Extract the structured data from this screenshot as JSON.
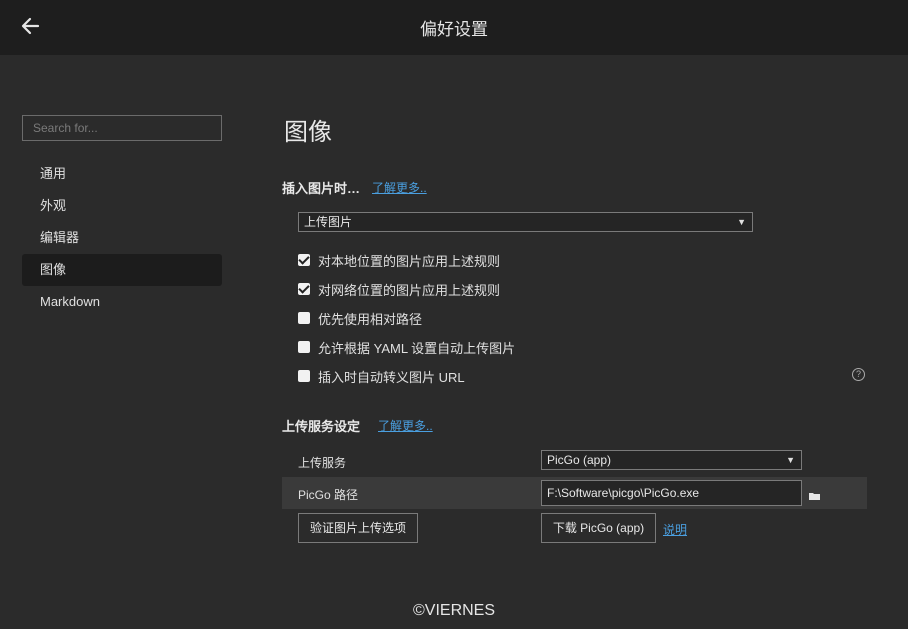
{
  "header": {
    "title": "偏好设置",
    "back_icon": "arrow-left-icon"
  },
  "sidebar": {
    "search_placeholder": "Search for...",
    "items": [
      {
        "label": "通用"
      },
      {
        "label": "外观"
      },
      {
        "label": "编辑器"
      },
      {
        "label": "图像",
        "active": true
      },
      {
        "label": "Markdown"
      }
    ]
  },
  "main": {
    "title": "图像",
    "insert_section": {
      "title": "插入图片时…",
      "learn_more": "了解更多..",
      "action_select": "上传图片",
      "options": [
        {
          "label": "对本地位置的图片应用上述规则",
          "checked": true
        },
        {
          "label": "对网络位置的图片应用上述规则",
          "checked": true
        },
        {
          "label": "优先使用相对路径",
          "checked": false
        },
        {
          "label": "允许根据 YAML 设置自动上传图片",
          "checked": false
        },
        {
          "label": "插入时自动转义图片 URL",
          "checked": false
        }
      ],
      "help_icon": "question-circle-icon"
    },
    "upload_section": {
      "title": "上传服务设定",
      "learn_more": "了解更多..",
      "service_label": "上传服务",
      "service_value": "PicGo (app)",
      "path_label": "PicGo 路径",
      "path_value": "F:\\Software\\picgo\\PicGo.exe",
      "folder_icon": "folder-icon",
      "verify_button": "验证图片上传选项",
      "download_button": "下载 PicGo (app)",
      "explain_link": "说明"
    }
  },
  "footer": {
    "text": "©VIERNES"
  },
  "colors": {
    "background": "#2b2b2b",
    "titlebar": "#1e1e1e",
    "link": "#4a9fe0",
    "active_nav": "#1c1c1c"
  }
}
